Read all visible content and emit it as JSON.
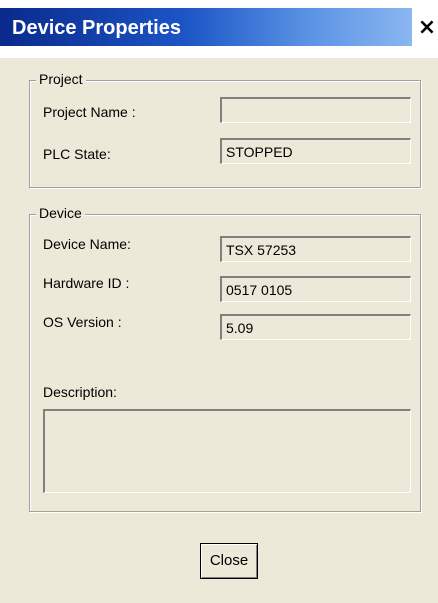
{
  "window": {
    "title": "Device Properties",
    "close_glyph": "×"
  },
  "project_group": {
    "legend": "Project",
    "project_name_label": "Project Name :",
    "project_name_value": "",
    "plc_state_label": "PLC State:",
    "plc_state_value": "STOPPED"
  },
  "device_group": {
    "legend": "Device",
    "device_name_label": "Device Name:",
    "device_name_value": "TSX 57253",
    "hardware_id_label": "Hardware ID :",
    "hardware_id_value": "0517 0105",
    "os_version_label": "OS Version :",
    "os_version_value": "5.09",
    "description_label": "Description:",
    "description_value": ""
  },
  "footer": {
    "close_button_label": "Close"
  }
}
